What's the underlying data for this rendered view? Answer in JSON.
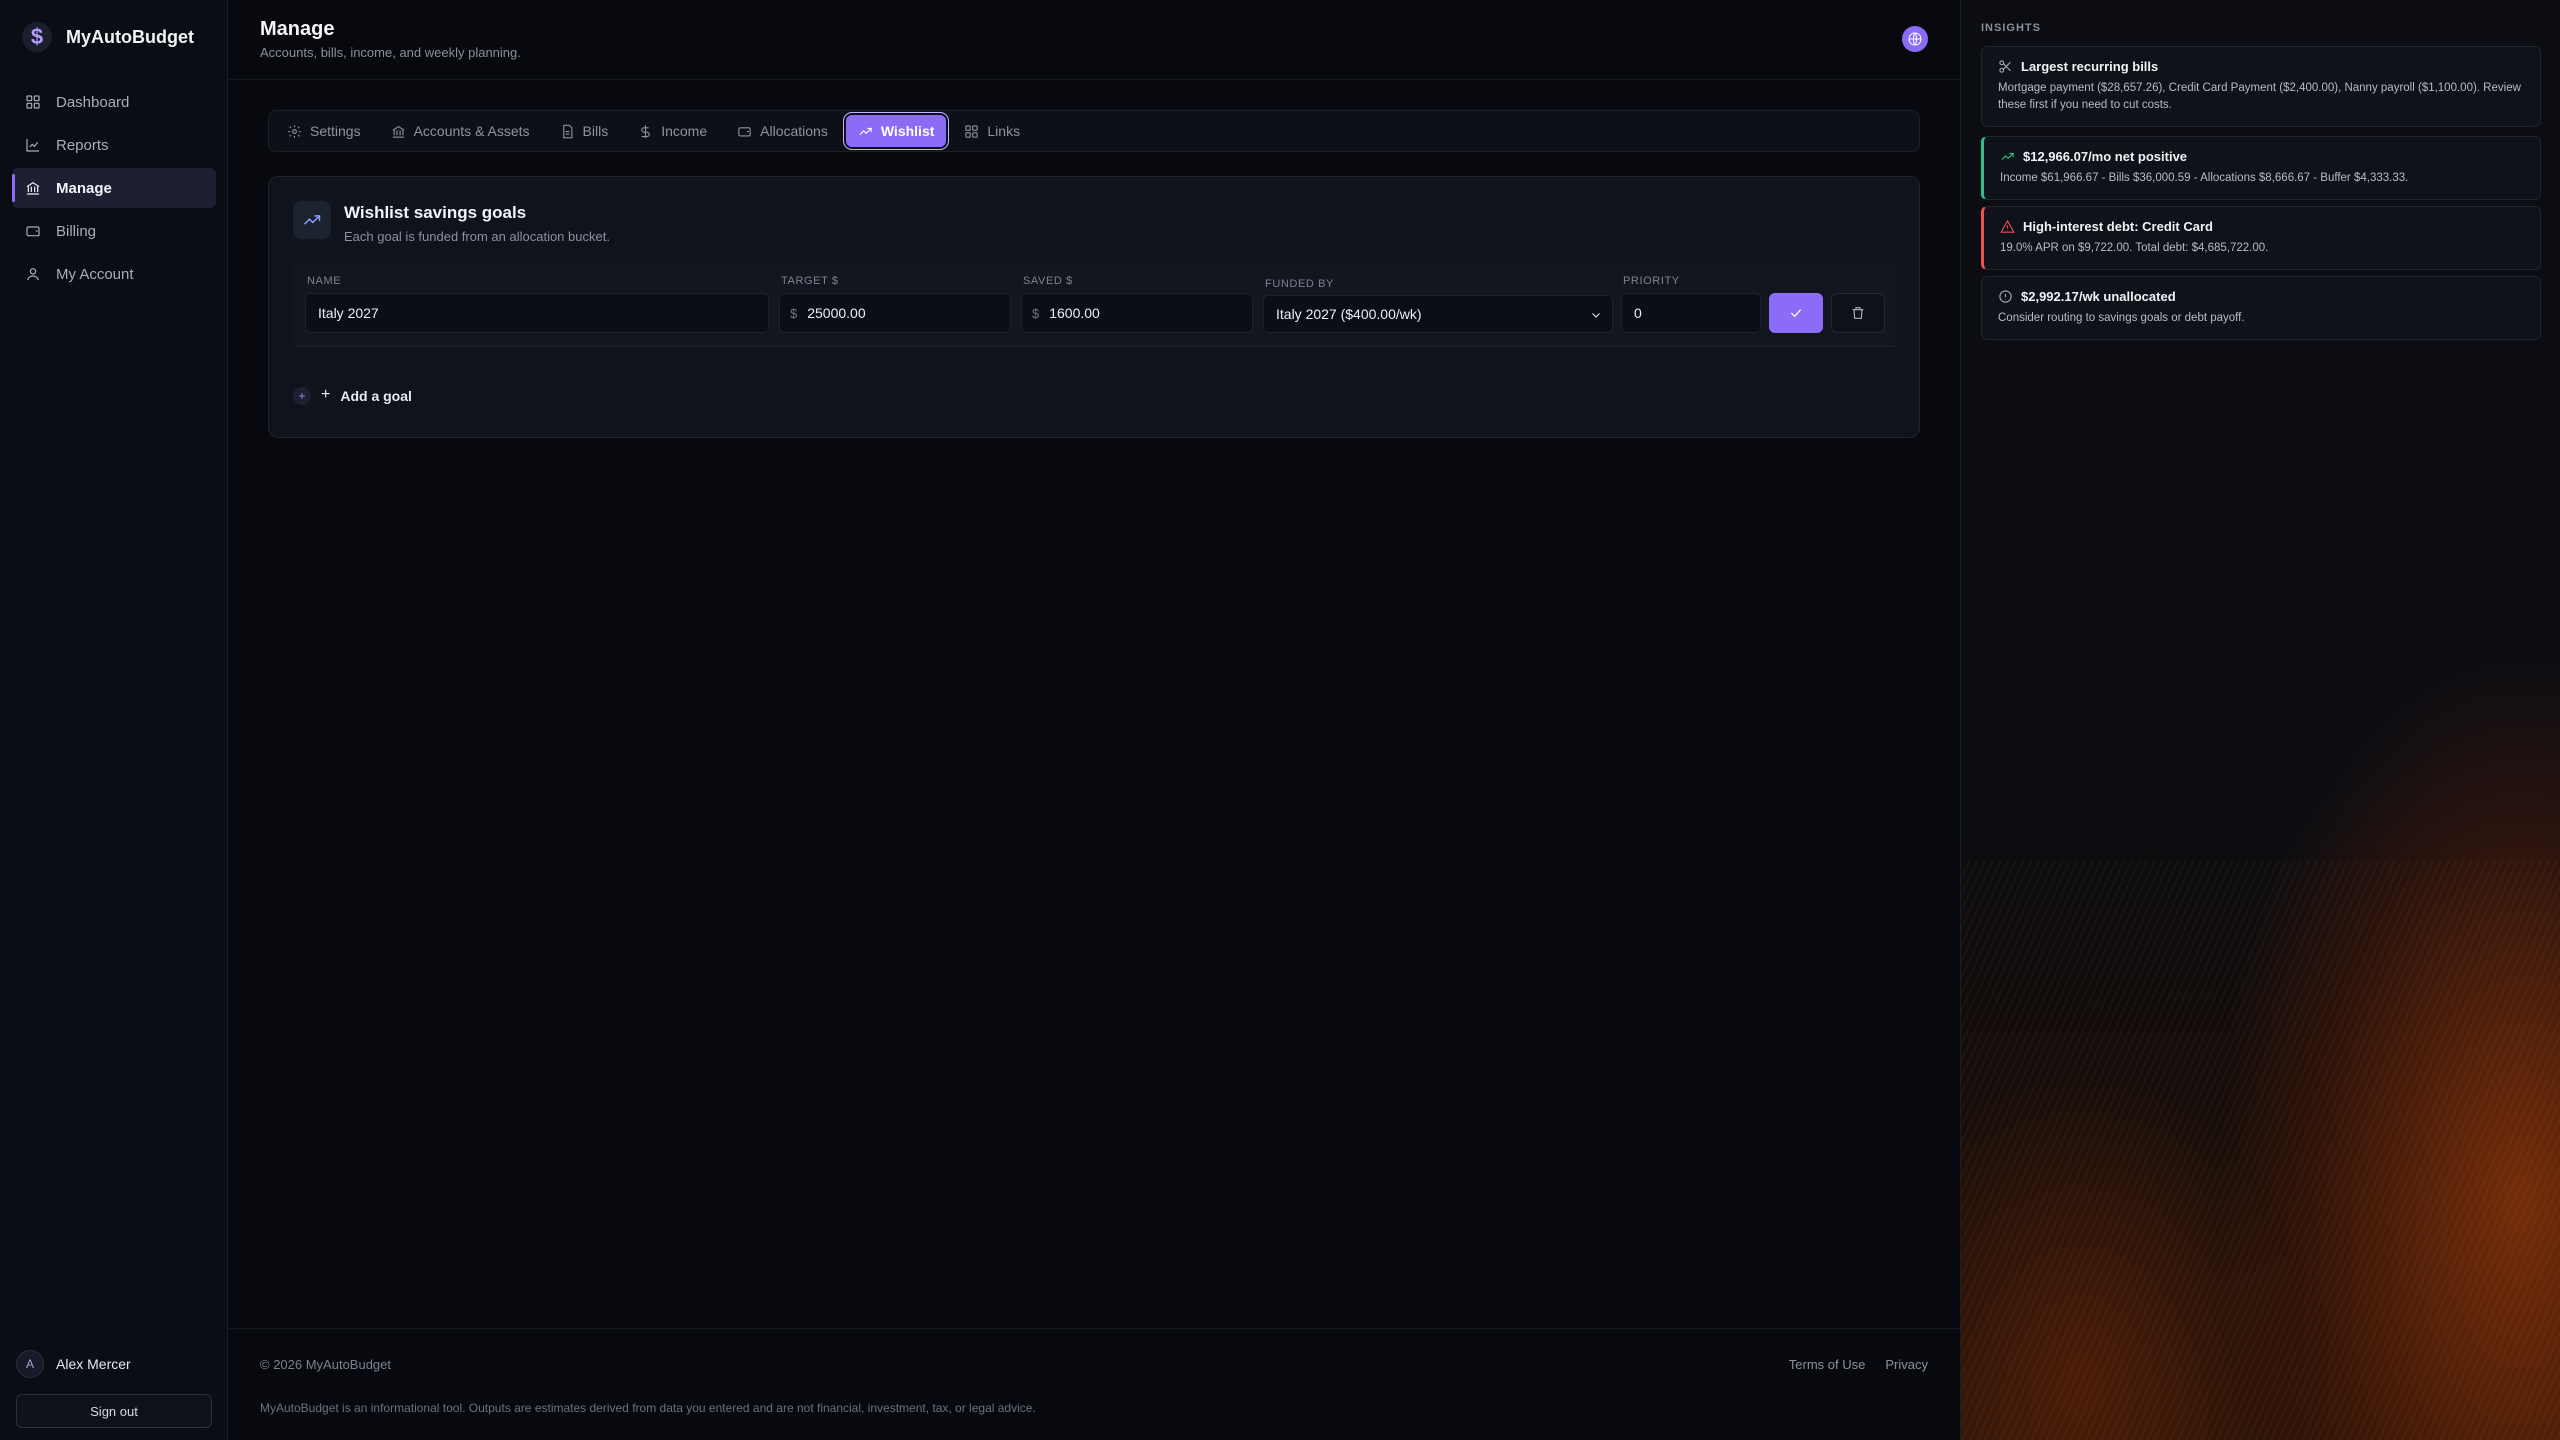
{
  "app": {
    "name": "MyAutoBudget",
    "logo_glyph": "$"
  },
  "sidebar": {
    "items": [
      {
        "label": "Dashboard",
        "icon": "grid-icon"
      },
      {
        "label": "Reports",
        "icon": "chart-line-icon"
      },
      {
        "label": "Manage",
        "icon": "bank-icon",
        "active": true
      },
      {
        "label": "Billing",
        "icon": "wallet-icon"
      },
      {
        "label": "My Account",
        "icon": "user-icon"
      }
    ],
    "user": {
      "initial": "A",
      "name": "Alex Mercer"
    },
    "signout_label": "Sign out"
  },
  "header": {
    "title": "Manage",
    "subtitle": "Accounts, bills, income, and weekly planning."
  },
  "tabs": [
    {
      "label": "Settings",
      "icon": "gear-icon"
    },
    {
      "label": "Accounts & Assets",
      "icon": "bank-icon"
    },
    {
      "label": "Bills",
      "icon": "document-icon"
    },
    {
      "label": "Income",
      "icon": "dollar-icon"
    },
    {
      "label": "Allocations",
      "icon": "wallet-icon"
    },
    {
      "label": "Wishlist",
      "icon": "trending-up-icon",
      "active": true
    },
    {
      "label": "Links",
      "icon": "grid-icon"
    }
  ],
  "wishlist": {
    "title": "Wishlist savings goals",
    "subtitle": "Each goal is funded from an allocation bucket.",
    "columns": {
      "name": "NAME",
      "target": "TARGET $",
      "saved": "SAVED $",
      "funded_by": "FUNDED BY",
      "priority": "PRIORITY"
    },
    "goals": [
      {
        "name": "Italy 2027",
        "currency_prefix": "$",
        "target": "25000.00",
        "saved": "1600.00",
        "funded_by": "Italy 2027 ($400.00/wk)",
        "priority": "0"
      }
    ],
    "add_goal_label": "Add a goal",
    "add_dot_glyph": "+",
    "add_plus_glyph": "+"
  },
  "footer": {
    "copyright": "© 2026 MyAutoBudget",
    "links": [
      "Terms of Use",
      "Privacy"
    ],
    "disclaimer": "MyAutoBudget is an informational tool. Outputs are estimates derived from data you entered and are not financial, investment, tax, or legal advice."
  },
  "insights": {
    "heading": "INSIGHTS",
    "cards": [
      {
        "title": "Largest recurring bills",
        "body": "Mortgage payment ($28,657.26), Credit Card Payment ($2,400.00), Nanny payroll ($1,100.00). Review these first if you need to cut costs.",
        "icon": "scissors-icon"
      },
      {
        "title": "$12,966.07/mo net positive",
        "body": "Income $61,966.67 - Bills $36,000.59 - Allocations $8,666.67 - Buffer $4,333.33.",
        "icon": "trending-up-icon",
        "accent": "#2bc28a"
      },
      {
        "title": "High-interest debt: Credit Card",
        "body": "19.0% APR on $9,722.00. Total debt: $4,685,722.00.",
        "icon": "warning-icon",
        "accent": "#ef5252"
      },
      {
        "title": "$2,992.17/wk unallocated",
        "body": "Consider routing to savings goals or debt payoff.",
        "icon": "info-circle-icon"
      }
    ]
  },
  "colors": {
    "accent": "#8b6cf6",
    "positive": "#2bc28a",
    "negative": "#ef5252"
  }
}
